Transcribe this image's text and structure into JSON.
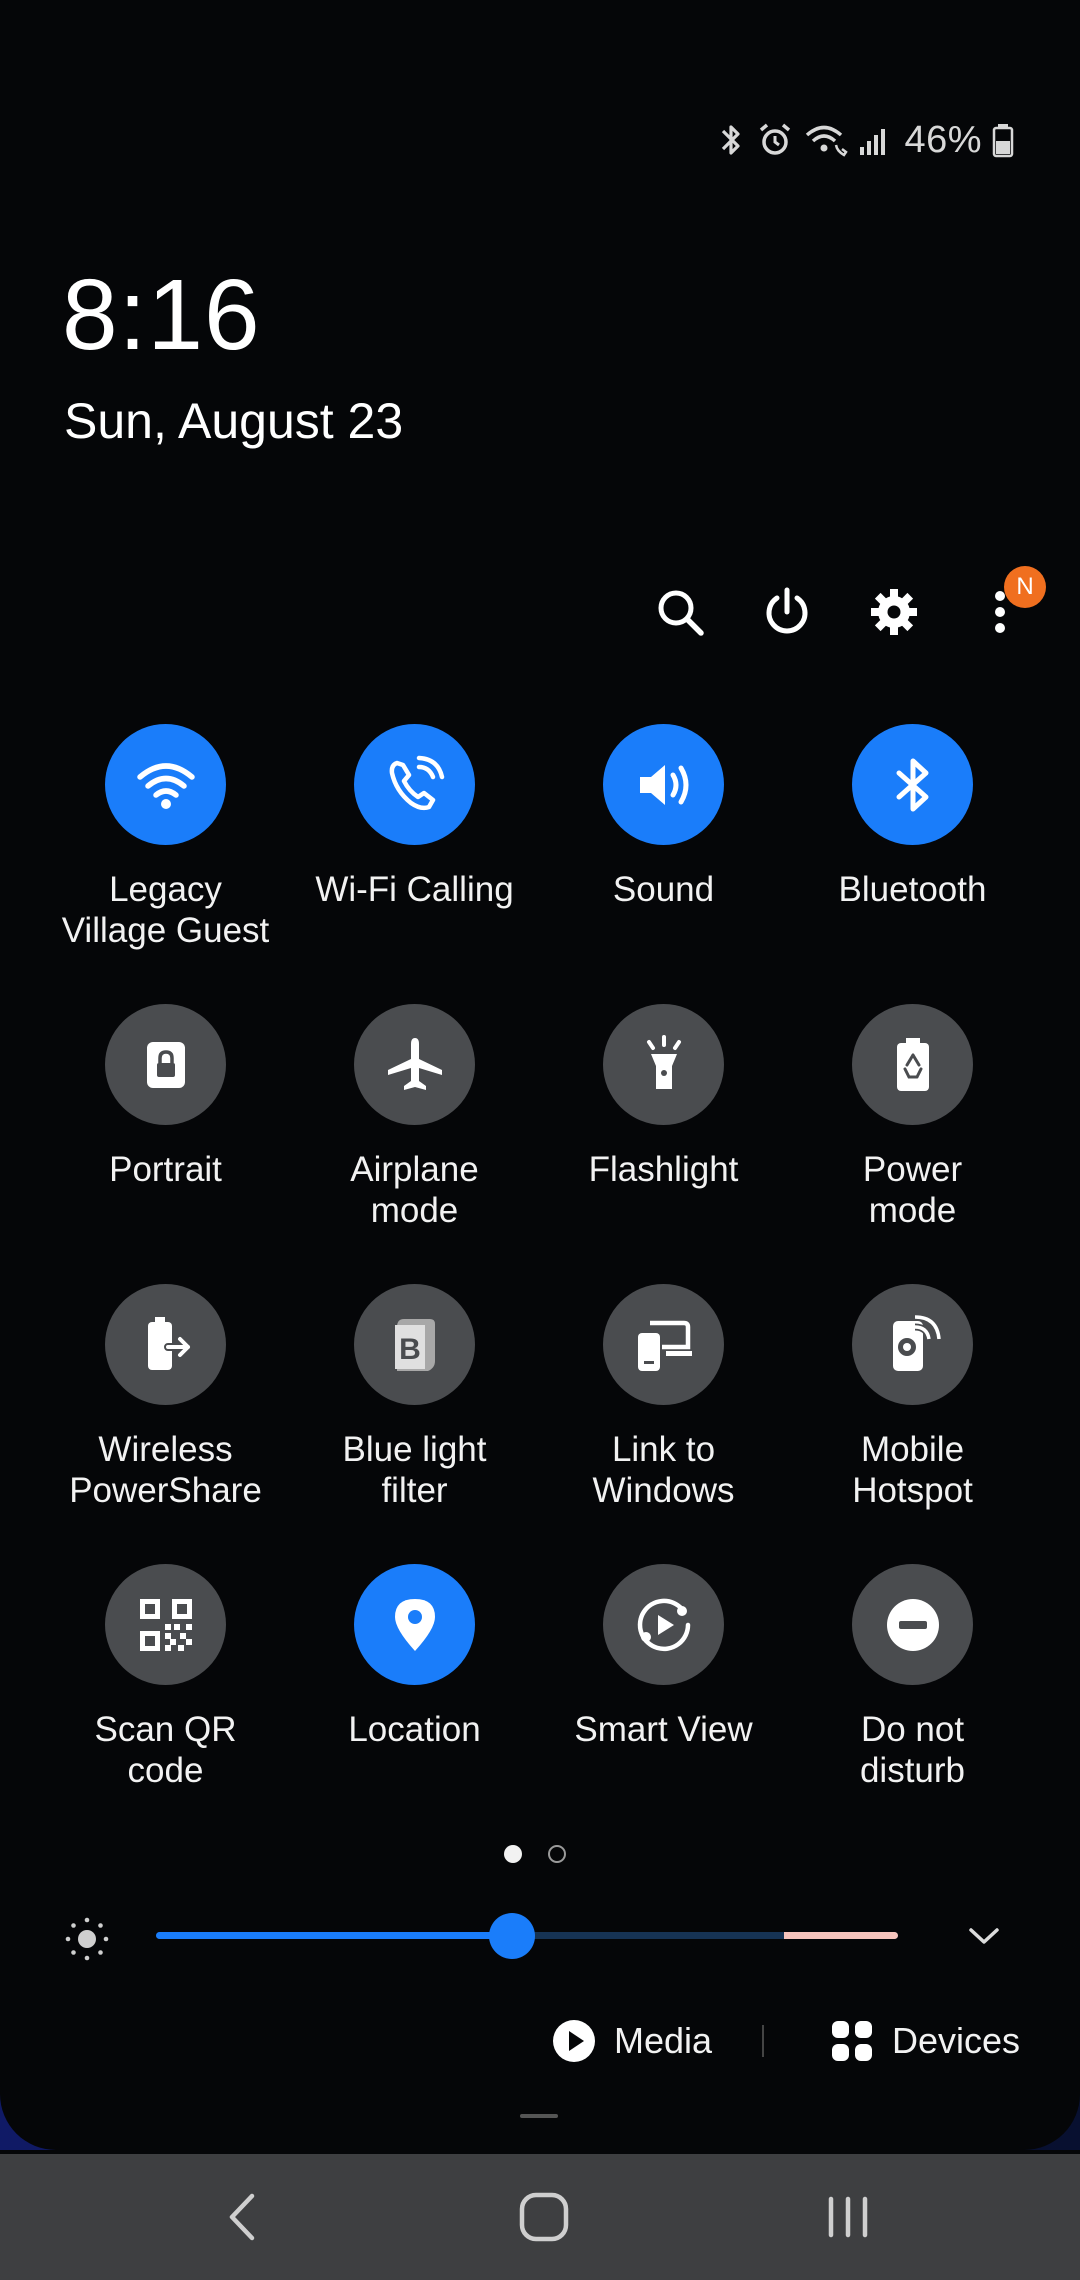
{
  "status_bar": {
    "icons": [
      "bluetooth-icon",
      "alarm-icon",
      "wifi-calling-icon",
      "signal-icon"
    ],
    "battery_percent": "46%"
  },
  "lock": {
    "time": "8:16",
    "date": "Sun, August 23"
  },
  "actions": {
    "icons": [
      "search-icon",
      "power-icon",
      "settings-icon",
      "more-icon"
    ],
    "notification_badge": "N"
  },
  "tiles": [
    {
      "label": "Legacy\nVillage Guest",
      "icon": "wifi-icon",
      "on": true
    },
    {
      "label": "Wi-Fi Calling",
      "icon": "wifi-calling-icon",
      "on": true
    },
    {
      "label": "Sound",
      "icon": "sound-icon",
      "on": true
    },
    {
      "label": "Bluetooth",
      "icon": "bluetooth-icon",
      "on": true
    },
    {
      "label": "Portrait",
      "icon": "portrait-lock-icon",
      "on": false
    },
    {
      "label": "Airplane\nmode",
      "icon": "airplane-icon",
      "on": false
    },
    {
      "label": "Flashlight",
      "icon": "flashlight-icon",
      "on": false
    },
    {
      "label": "Power\nmode",
      "icon": "power-mode-icon",
      "on": false
    },
    {
      "label": "Wireless\nPowerShare",
      "icon": "powershare-icon",
      "on": false
    },
    {
      "label": "Blue light\nfilter",
      "icon": "blue-light-icon",
      "on": false
    },
    {
      "label": "Link to\nWindows",
      "icon": "link-windows-icon",
      "on": false
    },
    {
      "label": "Mobile\nHotspot",
      "icon": "hotspot-icon",
      "on": false
    },
    {
      "label": "Scan QR\ncode",
      "icon": "qr-code-icon",
      "on": false
    },
    {
      "label": "Location",
      "icon": "location-icon",
      "on": true
    },
    {
      "label": "Smart View",
      "icon": "smart-view-icon",
      "on": false
    },
    {
      "label": "Do not\ndisturb",
      "icon": "dnd-icon",
      "on": false
    }
  ],
  "pagination": {
    "current": 1,
    "total": 2
  },
  "brightness": {
    "level": 0.48
  },
  "media": {
    "media_label": "Media",
    "devices_label": "Devices"
  },
  "colors": {
    "accent": "#1a7dfa",
    "tile_off": "#4a4c4f",
    "badge": "#f06f1f"
  },
  "navigation": [
    "back-icon",
    "home-icon",
    "recents-icon"
  ]
}
